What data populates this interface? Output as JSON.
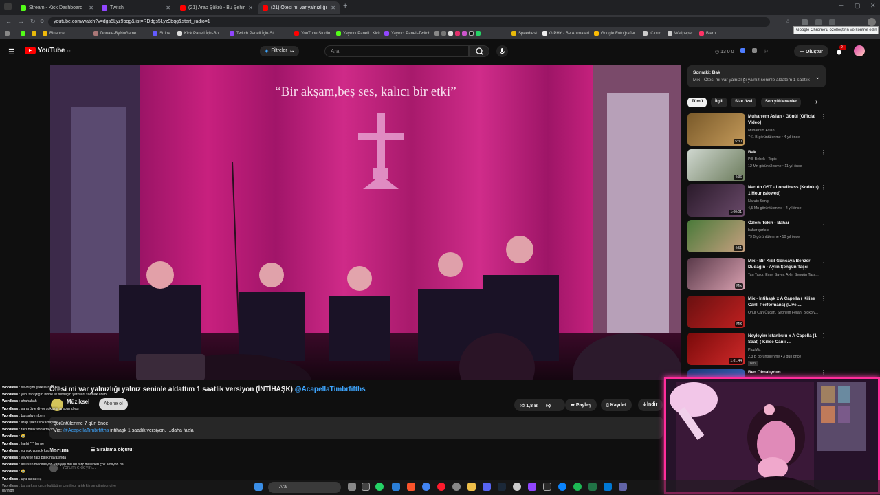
{
  "browser": {
    "tabs": [
      {
        "title": "Stream - Kick Dashboard",
        "color": "#53fc18"
      },
      {
        "title": "Twitch",
        "color": "#9146ff"
      },
      {
        "title": "(21) Arap Şükrü - Bu Şehir Beni",
        "color": "#ff0000"
      },
      {
        "title": "(21) Ötesi mi var yalnızlığı y",
        "color": "#ff0000"
      }
    ],
    "new_tab": "+",
    "url": "youtube.com/watch?v=dgs5Lyz9bqg&list=RDdgs5Lyz9bqg&start_radio=1",
    "tooltip": "Google Chrome'u özelleştirin ve kontrol edin",
    "bookmarks": [
      "Binance",
      "Donate-ByNoGame",
      "Stripe",
      "Kick Paneli İçin-Bot...",
      "Twitch Paneli İçin-St...",
      "YouTube Studio",
      "Yayıncı Paneli | Kick",
      "Yayıncı Paneli-Twitch",
      "Speedtest",
      "GIPHY - Be Animated",
      "Google Fotoğraflar",
      "iCloud",
      "Wallpaper",
      "Blerp"
    ]
  },
  "youtube": {
    "logo": "YouTube",
    "logo_sup": "TR",
    "filters_label": "Filtreler",
    "search_placeholder": "Ara",
    "header_stats": "13  0  0",
    "create_label": "Oluştur",
    "notifications_count": "9+",
    "video_caption": "“Bir akşam,beş ses, kalıcı bir etki”",
    "video_title": "Ötesi mi var yalnızlığı yalnız seninle aldattım 1 saatlik versiyon (İNTİHAŞK)",
    "video_title_tag": "@AcapellaTimbrfifths",
    "channel_name": "Müziksel",
    "subscribe_label": "Abone ol",
    "like_count": "1,8 B",
    "share_label": "Paylaş",
    "save_label": "Kaydet",
    "download_label": "İndir",
    "desc_stats": "görüntülenme  7 gün önce",
    "desc_via": "Via:",
    "desc_handle": "@AcapellaTimbrfifths",
    "desc_text": "intihaşk 1 saatlik versiyon. ...daha fazla",
    "comments_heading": "Yorum",
    "sort_label": "Sıralama ölçütü:",
    "add_comment": "Yorum ekleyin..."
  },
  "sidebar": {
    "next_title": "Sonraki: Bak",
    "next_sub": "Mix - Ötesi mi var yalnızlığı yalnız seninle aldattım 1 saatlik v...",
    "chips": [
      "Tümü",
      "İlgili",
      "Size özel",
      "Son yüklenenler"
    ],
    "recommendations": [
      {
        "title": "Muharrem Aslan - Gönül [Official Video]",
        "channel": "Muharrem Aslan",
        "meta": "741 B görüntülenme • 4 yıl önce",
        "duration": "5:30",
        "c1": "#7a5a2a",
        "c2": "#c49a5a"
      },
      {
        "title": "Bak",
        "channel": "Pilli Bebek - Topic",
        "meta": "12 Mn görüntülenme • 11 yıl önce",
        "duration": "4:36",
        "c1": "#cfd7cf",
        "c2": "#6a7a5a"
      },
      {
        "title": "Naruto OST - Loneliness (Kodoku) 1 Hour (slowed)",
        "channel": "Naruto Song",
        "meta": "4,5 Mn görüntülenme • 4 yıl önce",
        "duration": "1:00:01",
        "c1": "#2a1a2a",
        "c2": "#6a4a6a"
      },
      {
        "title": "Özlem Tekin - Bahar",
        "channel": "bahar şarkısı",
        "meta": "79 B görüntülenme • 10 yıl önce",
        "duration": "4:51",
        "c1": "#4a7a3a",
        "c2": "#c8a080"
      },
      {
        "title": "Mix - Bir Kızıl Goncaya Benzer Dudağın - Aylin Şengün Taşçı",
        "channel": "Tan Taşçı, Emel Sayın, Aylin Şengün Taşç...",
        "meta": "",
        "duration": "Mix",
        "c1": "#5a3a4a",
        "c2": "#d9a0b0"
      },
      {
        "title": "Mix - İntihaşk x A Capella ( Kilise Canlı Performans) (Live ...",
        "channel": "Onur Can Özcan, Şebnem Ferah, Blok3 v...",
        "meta": "",
        "duration": "Mix",
        "c1": "#6a1010",
        "c2": "#c02020"
      },
      {
        "title": "Neyleyim İstanbulu x A Capella (1 Saat) ( Kilise Canlı ...",
        "channel": "PluzMix",
        "meta": "2,3 B görüntülenme • 3 gün önce",
        "badge": "Yeni",
        "duration": "1:01:44",
        "c1": "#7a0a0a",
        "c2": "#d02a2a"
      },
      {
        "title": "Ben Olmalıydım",
        "channel": "",
        "meta": "",
        "duration": "",
        "c1": "#1a3a7a",
        "c2": "#3a6ac0"
      }
    ]
  },
  "chat": {
    "user": "Wordless",
    "messages": [
      "sevdiğim şarkılardan biri",
      "yeni tanıştığın birine ilk sevdiğin şarkıları sormak abim",
      "ahahahah",
      "sana öyle diyor sokakta araplar diyor",
      "bursalıyım ben",
      "arap şükrü sokaktayım",
      "rakı balık sokaktayım",
      "🥹",
      "harbi *** bu ne",
      "yumuk yumuk kadınlar",
      "veyleke rakı balık havasında",
      "asıl sen meditasyon yapıyon mu bu tarz müzikleri çok seviyon da",
      "🥹",
      "uyanamamış",
      "bu şarkılar gece kulübüne çevriliyor artık kimse gitmiyor diye"
    ],
    "stream_footer": "dx/jhigh"
  },
  "taskbar": {
    "search_placeholder": "Ara"
  }
}
